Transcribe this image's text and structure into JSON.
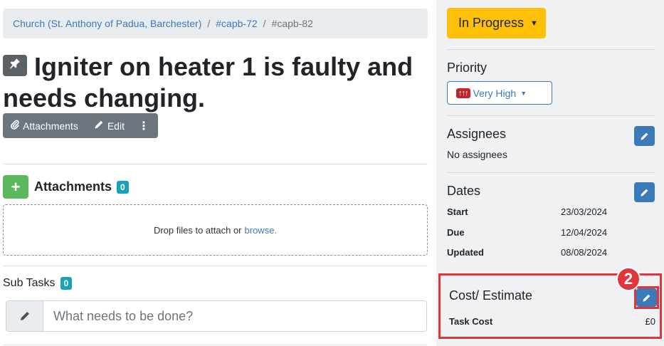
{
  "breadcrumb": {
    "items": [
      "Church (St. Anthony of Padua, Barchester)",
      "#capb-72"
    ],
    "current": "#capb-82"
  },
  "task": {
    "title": "Igniter on heater 1 is faulty and needs changing."
  },
  "toolbar": {
    "attachments_label": "Attachments",
    "edit_label": "Edit",
    "more_label": "⋮"
  },
  "attachments": {
    "heading": "Attachments",
    "count": "0",
    "drop_text": "Drop files to attach or",
    "browse_link": "browse."
  },
  "subtasks": {
    "heading": "Sub Tasks",
    "count": "0",
    "input_placeholder": "What needs to be done?"
  },
  "sidebar": {
    "status_label": "In Progress",
    "priority": {
      "heading": "Priority",
      "flag": "↑↑↑",
      "value": "Very High"
    },
    "assignees": {
      "heading": "Assignees",
      "empty_text": "No assignees"
    },
    "dates": {
      "heading": "Dates",
      "rows": [
        {
          "label": "Start",
          "value": "23/03/2024"
        },
        {
          "label": "Due",
          "value": "12/04/2024"
        },
        {
          "label": "Updated",
          "value": "08/08/2024"
        }
      ]
    },
    "cost": {
      "heading": "Cost/ Estimate",
      "row_label": "Task Cost",
      "row_value": "£0"
    }
  },
  "annotation": {
    "step_number": "2"
  },
  "colors": {
    "status": "#ffc107",
    "primary": "#3c79b9",
    "success": "#5cb85c",
    "badge": "#17a2b8",
    "highlight": "#e1353d"
  }
}
